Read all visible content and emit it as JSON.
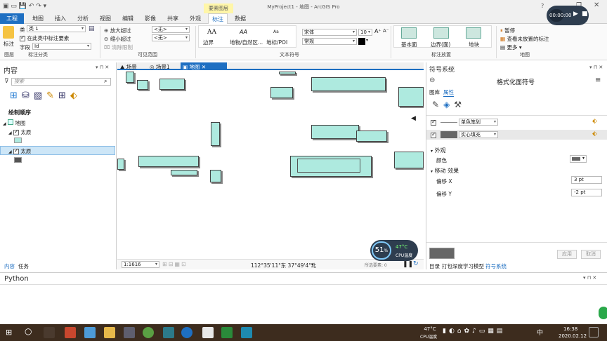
{
  "window": {
    "title": "MyProject1 - 地图 - ArcGIS Pro",
    "context_tab": "要素图层",
    "help": "?"
  },
  "tabs": [
    "工程",
    "地图",
    "插入",
    "分析",
    "视图",
    "编辑",
    "影像",
    "共享",
    "外观",
    "标注",
    "数据"
  ],
  "active_tab": "标注",
  "ribbon": {
    "label_btn": "标注",
    "class_label": "类",
    "class_value": "类 1",
    "label_features_in_class": "在此类中标注要素",
    "field_label": "字段",
    "field_value": "Id",
    "zoom_in_limit": "放大超过",
    "zoom_out_limit": "缩小超过",
    "clear_limits": "清除限制",
    "none1": "<无>",
    "none2": "<无>",
    "group_label_class": "标注分类",
    "group_visible_range": "可见范围",
    "styles": [
      "边界",
      "地物/自然区...",
      "地标/POI"
    ],
    "font": "宋体",
    "font_size": "10",
    "font_style": "常规",
    "group_text_symbol": "文本符号",
    "placements": [
      "基本面",
      "边界(面)",
      "地块"
    ],
    "group_label_placement": "标注放置",
    "pause": "暂停",
    "view_unplaced": "查看未放置的标注",
    "more": "更多",
    "group_map": "地图",
    "group_layer": "图层"
  },
  "recording": {
    "time": "00:00:00"
  },
  "contents": {
    "title": "内容",
    "search_placeholder": "搜索",
    "drawing_order": "绘制顺序",
    "map_name": "地图",
    "layers": [
      "太原",
      "太原"
    ],
    "bottom_tabs": [
      "内容",
      "任务"
    ]
  },
  "map_tabs": [
    "场景",
    "场景1",
    "地图"
  ],
  "map_status": {
    "scale": "1:1616",
    "coords": "112°35'11\"东 37°49'4\"北",
    "selected": "所选要素: 0"
  },
  "cpu": {
    "percent": "51",
    "unit": "%",
    "temp": "47°C",
    "label": "CPU温度"
  },
  "symbology": {
    "pane_title": "符号系统",
    "format_title": "格式化面符号",
    "tabs": [
      "图库",
      "属性"
    ],
    "layers": [
      "单色笔划",
      "实心填充"
    ],
    "appearance": "外观",
    "color_label": "颜色",
    "move_effect": "移动 效果",
    "offset_x_label": "偏移 X",
    "offset_x_value": "3 pt",
    "offset_y_label": "偏移 Y",
    "offset_y_value": "-2 pt",
    "apply": "应用",
    "cancel": "取消",
    "bottom_tabs": [
      "目录",
      "打包深度学习模型",
      "符号系统"
    ]
  },
  "python": {
    "title": "Python"
  },
  "taskbar": {
    "temp": "47°C",
    "temp_label": "CPU温度",
    "ime": "中",
    "time": "16:38",
    "date": "2020.02.12"
  }
}
